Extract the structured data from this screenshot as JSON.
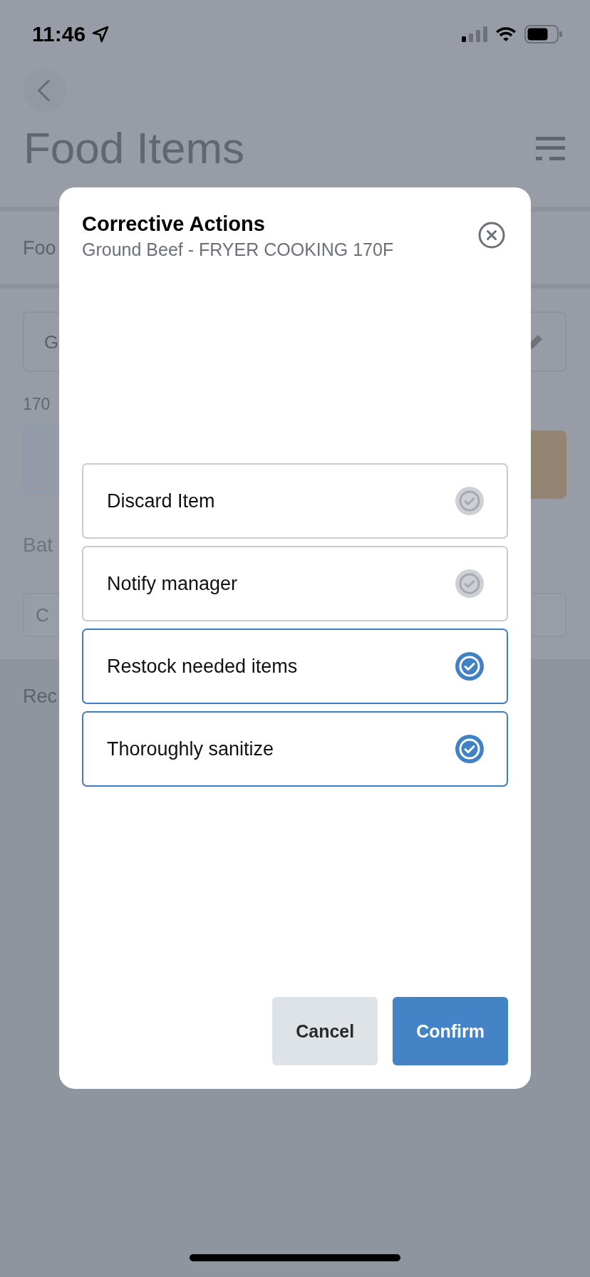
{
  "status_bar": {
    "time": "11:46"
  },
  "header": {
    "title": "Food Items"
  },
  "page_behind": {
    "row_text": "Foo",
    "field_value": "G",
    "label": "170",
    "section_label": "Bat",
    "input_placeholder": "C",
    "section_heading": "Rec"
  },
  "modal": {
    "title": "Corrective Actions",
    "subtitle": "Ground Beef - FRYER COOKING 170F",
    "options": [
      {
        "label": "Discard Item",
        "checked": false
      },
      {
        "label": "Notify manager",
        "checked": false
      },
      {
        "label": "Restock needed items",
        "checked": true
      },
      {
        "label": "Thoroughly sanitize",
        "checked": true
      }
    ],
    "buttons": [
      {
        "label": "Cancel",
        "kind": "secondary"
      },
      {
        "label": "Confirm",
        "kind": "primary"
      }
    ]
  }
}
